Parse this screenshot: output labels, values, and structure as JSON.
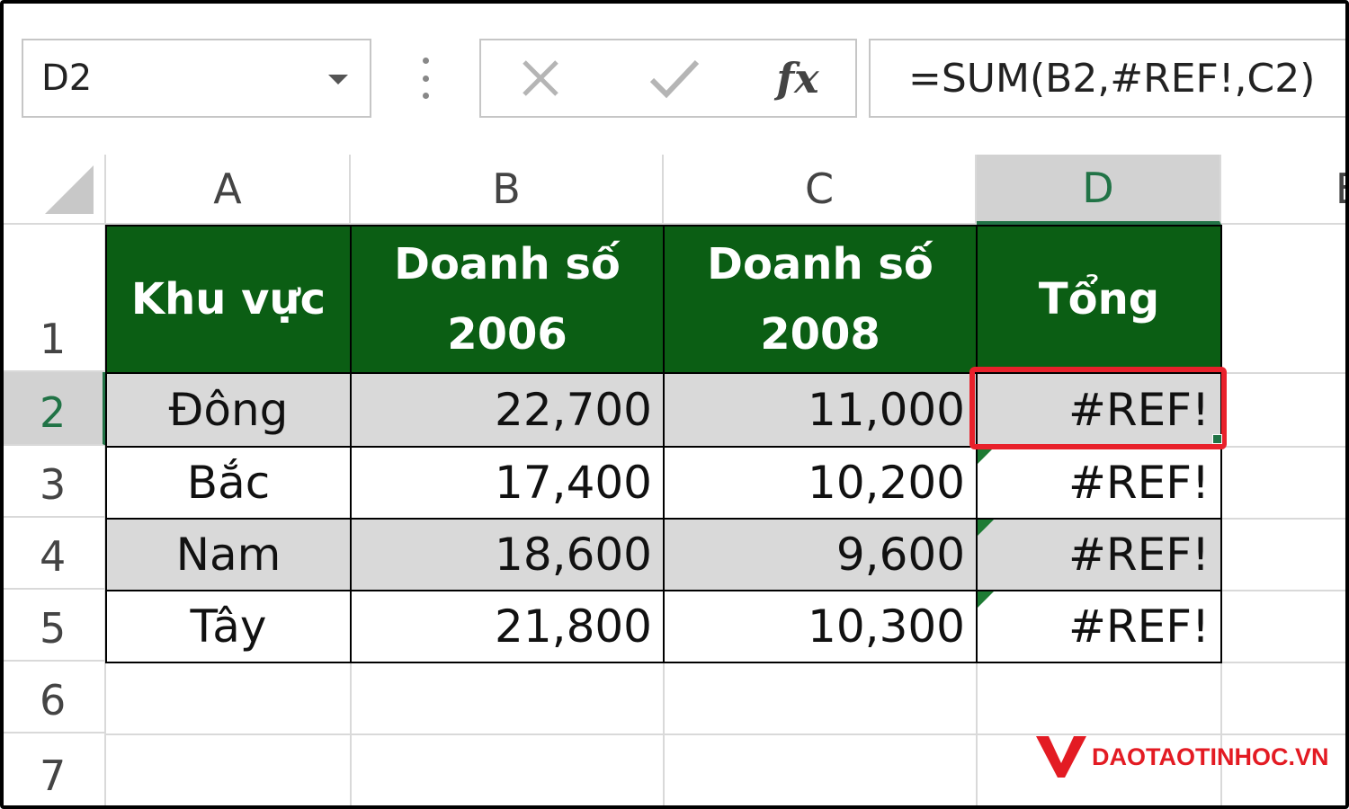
{
  "formula_bar": {
    "name_box": "D2",
    "cancel_icon": "x-icon",
    "enter_icon": "check-icon",
    "fx_label": "fx",
    "formula": "=SUM(B2,#REF!,C2)"
  },
  "columns": [
    "A",
    "B",
    "C",
    "D",
    "E"
  ],
  "rows": [
    "1",
    "2",
    "3",
    "4",
    "5",
    "6",
    "7"
  ],
  "table": {
    "headers": [
      {
        "line1": "Khu vực",
        "line2": ""
      },
      {
        "line1": "Doanh số",
        "line2": "2006"
      },
      {
        "line1": "Doanh số",
        "line2": "2008"
      },
      {
        "line1": "Tổng",
        "line2": ""
      }
    ],
    "rows": [
      {
        "region": "Đông",
        "s2006": "22,700",
        "s2008": "11,000",
        "total": "#REF!"
      },
      {
        "region": "Bắc",
        "s2006": "17,400",
        "s2008": "10,200",
        "total": "#REF!"
      },
      {
        "region": "Nam",
        "s2006": "18,600",
        "s2008": "9,600",
        "total": "#REF!"
      },
      {
        "region": "Tây",
        "s2006": "21,800",
        "s2008": "10,300",
        "total": "#REF!"
      }
    ]
  },
  "colors": {
    "header_fill": "#0b5e14",
    "band_fill": "#d9d9d9",
    "selection_highlight": "#e8212b",
    "excel_green": "#217346"
  },
  "watermark": {
    "text": "DAOTAOTINHOC.VN",
    "logo_icon": "v-logo-icon"
  }
}
